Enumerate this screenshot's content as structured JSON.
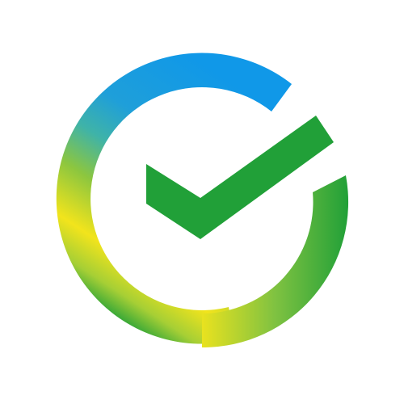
{
  "logo": {
    "icon": "circular-checkmark-logo",
    "colors": {
      "background": "#ffffff",
      "check": "#21a038",
      "ring_blue": "#1098e8",
      "ring_teal": "#3fb3a8",
      "ring_lightgreen": "#8cc63f",
      "ring_yellow": "#f2e41c",
      "ring_green": "#21a038"
    }
  }
}
